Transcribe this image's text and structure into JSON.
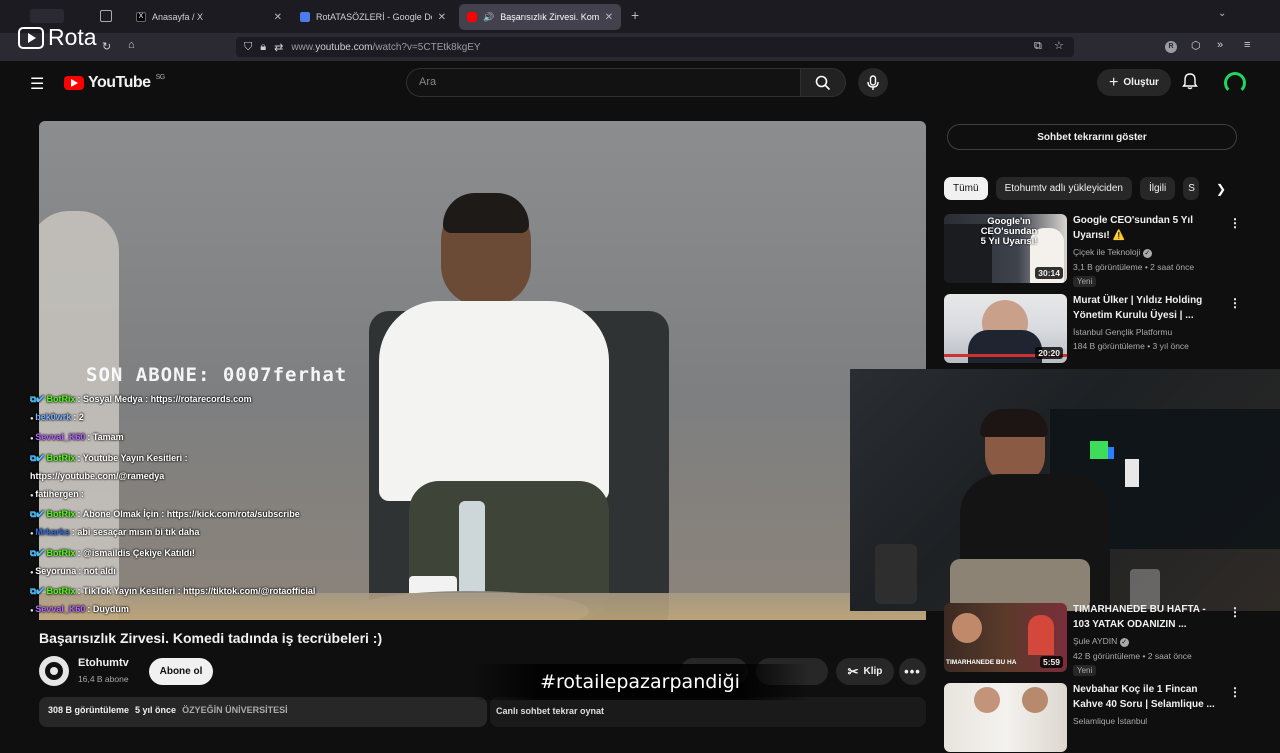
{
  "browser": {
    "tabs": [
      {
        "title": "",
        "active": false
      },
      {
        "title": "Anasayfa / X",
        "active": false
      },
      {
        "title": "RotATASÖZLERİ - Google Doküm",
        "active": false
      },
      {
        "title": "Başarısızlık Zirvesi. Komedi",
        "active": true
      }
    ],
    "new_tab": "+",
    "url_prefix": "www.",
    "url_domain": "youtube.com",
    "url_path": "/watch?v=5CTEtk8kgEY"
  },
  "overlay": {
    "brand": "Rota",
    "last_sub": "SON ABONE: 0007ferhat",
    "hashtag": "#rotailepazarpandiği"
  },
  "chat": [
    {
      "user": "BotRix",
      "text": ": Sosyal Medya : https://rotarecords.com",
      "color": "#53fc18"
    },
    {
      "user": "bek0wrk",
      "text": ": 2",
      "color": "#7fb2ff"
    },
    {
      "user": "Sevval_K60",
      "text": ": Tamam",
      "color": "#b565ff"
    },
    {
      "user": "BotRix",
      "text": ": Youtube Yayın Kesitleri :",
      "color": "#53fc18"
    },
    {
      "user": "",
      "text": "https://youtube.com/@ramedya",
      "color": "#ffffff"
    },
    {
      "user": "fatihergen",
      "text": ":",
      "color": "#ffffff"
    },
    {
      "user": "BotRix",
      "text": ": Abone Olmak İçin : https://kick.com/rota/subscribe",
      "color": "#53fc18"
    },
    {
      "user": "Mrkarks",
      "text": ": abi sesaçar mısın bi tık daha",
      "color": "#2e6bd6"
    },
    {
      "user": "BotRix",
      "text": ": @ismaildis Çekiye Katıldı!",
      "color": "#53fc18"
    },
    {
      "user": "Seyoruna",
      "text": ": not aldı",
      "color": "#ffffff"
    },
    {
      "user": "BotRix",
      "text": ": TikTok Yayın Kesitleri : https://tiktok.com/@rotaofficial",
      "color": "#53fc18"
    },
    {
      "user": "Sevval_K60",
      "text": ": Duydum",
      "color": "#b565ff"
    }
  ],
  "youtube": {
    "logo_text": "YouTube",
    "region": "SG",
    "search_placeholder": "Ara",
    "create_label": "Oluştur",
    "chat_replay_label": "Sohbet tekrarını göster",
    "chips": [
      "Tümü",
      "Etohumtv adlı yükleyiciden",
      "İlgili",
      "S"
    ],
    "video_title": "Başarısızlık Zirvesi. Komedi tadında iş tecrübeleri :)",
    "channel_name": "Etohumtv",
    "channel_subs": "16,4 B abone",
    "subscribe_label": "Abone ol",
    "clip_label": "Klip",
    "desc_views": "308 B görüntüleme",
    "desc_age": "5 yıl önce",
    "desc_tag": "ÖZYEĞİN ÜNİVERSİTESİ",
    "replay_text": "Canlı sohbet tekrar oynat"
  },
  "recommendations": [
    {
      "title": "Google CEO'sundan 5 Yıl Uyarısı! ⚠️",
      "channel": "Çiçek ile Teknoloji",
      "verified": true,
      "meta": "3,1 B görüntüleme • 2 saat önce",
      "badge": "Yeni",
      "duration": "30:14",
      "thumb_text": "Google'ın CEO'sundan 5 Yıl Uyarısı!"
    },
    {
      "title": "Murat Ülker | Yıldız Holding Yönetim Kurulu Üyesi | ...",
      "channel": "İstanbul Gençlik Platformu",
      "verified": false,
      "meta": "184 B görüntüleme • 3 yıl önce",
      "badge": "",
      "duration": "20:20",
      "thumb_text": ""
    },
    {
      "title": "TIMARHANEDE BU HAFTA - 103 YATAK ODANIZIN ...",
      "channel": "Şule AYDIN",
      "verified": true,
      "meta": "42 B görüntüleme • 2 saat önce",
      "badge": "Yeni",
      "duration": "5:59",
      "thumb_text": "TIMARHANEDE BU HA"
    },
    {
      "title": "Nevbahar Koç ile 1 Fincan Kahve 40 Soru | Selamlique ...",
      "channel": "Selamlique İstanbul",
      "verified": false,
      "meta": "",
      "badge": "",
      "duration": "",
      "thumb_text": ""
    }
  ],
  "colors": {
    "yt_red": "#ff0000",
    "bg": "#0f0f0f",
    "botrix_green": "#53fc18"
  }
}
